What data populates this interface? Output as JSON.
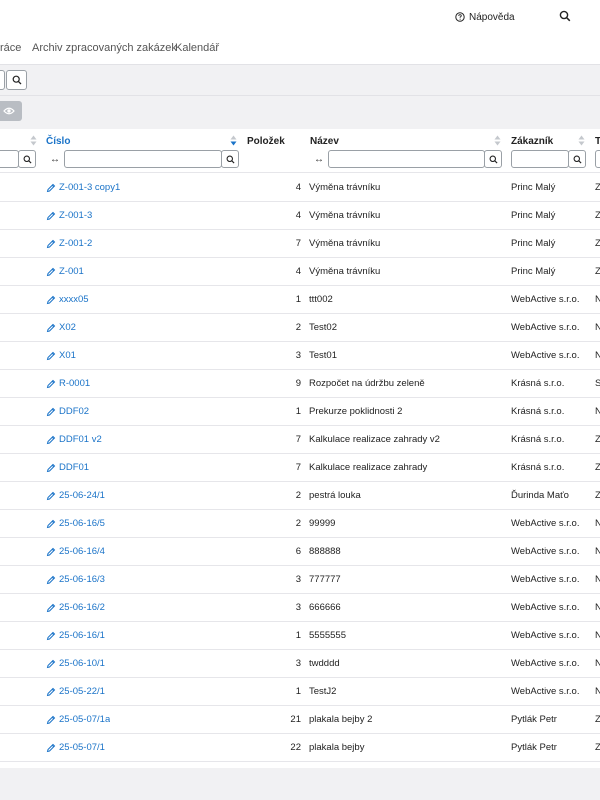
{
  "header": {
    "help_label": "Nápověda",
    "help_icon": "question-circle-icon",
    "search_icon": "search-icon"
  },
  "nav": {
    "items": [
      "ráce",
      "Archiv zpracovaných zakázek",
      "Kalendář"
    ]
  },
  "toolbar": {
    "search_icon": "search-icon",
    "visibility_icon": "eye-icon"
  },
  "table": {
    "columns": {
      "cislo": "Číslo",
      "polozek": "Položek",
      "nazev": "Název",
      "zakaznik": "Zákazník",
      "t": "T"
    },
    "expand_glyph": "↔",
    "accent_color": "#1a73c8",
    "rows": [
      {
        "cislo": "Z-001-3 copy1",
        "polozek": "4",
        "nazev": "Výměna trávníku",
        "zakaznik": "Princ Malý",
        "t": "Z"
      },
      {
        "cislo": "Z-001-3",
        "polozek": "4",
        "nazev": "Výměna trávníku",
        "zakaznik": "Princ Malý",
        "t": "Z"
      },
      {
        "cislo": "Z-001-2",
        "polozek": "7",
        "nazev": "Výměna trávníku",
        "zakaznik": "Princ Malý",
        "t": "Z"
      },
      {
        "cislo": "Z-001",
        "polozek": "4",
        "nazev": "Výměna trávníku",
        "zakaznik": "Princ Malý",
        "t": "Z"
      },
      {
        "cislo": "xxxx05",
        "polozek": "1",
        "nazev": "ttt002",
        "zakaznik": "WebActive s.r.o.",
        "t": "N"
      },
      {
        "cislo": "X02",
        "polozek": "2",
        "nazev": "Test02",
        "zakaznik": "WebActive s.r.o.",
        "t": "N"
      },
      {
        "cislo": "X01",
        "polozek": "3",
        "nazev": "Test01",
        "zakaznik": "WebActive s.r.o.",
        "t": "N"
      },
      {
        "cislo": "R-0001",
        "polozek": "9",
        "nazev": "Rozpočet na údržbu zeleně",
        "zakaznik": "Krásná s.r.o.",
        "t": "S"
      },
      {
        "cislo": "DDF02",
        "polozek": "1",
        "nazev": "Prekurze poklidnosti 2",
        "zakaznik": "Krásná s.r.o.",
        "t": "N"
      },
      {
        "cislo": "DDF01 v2",
        "polozek": "7",
        "nazev": "Kalkulace realizace zahrady v2",
        "zakaznik": "Krásná s.r.o.",
        "t": "Z"
      },
      {
        "cislo": "DDF01",
        "polozek": "7",
        "nazev": "Kalkulace realizace zahrady",
        "zakaznik": "Krásná s.r.o.",
        "t": "Z"
      },
      {
        "cislo": "25-06-24/1",
        "polozek": "2",
        "nazev": "pestrá louka",
        "zakaznik": "Ďurinda Maťo",
        "t": "Z"
      },
      {
        "cislo": "25-06-16/5",
        "polozek": "2",
        "nazev": "99999",
        "zakaznik": "WebActive s.r.o.",
        "t": "N"
      },
      {
        "cislo": "25-06-16/4",
        "polozek": "6",
        "nazev": "888888",
        "zakaznik": "WebActive s.r.o.",
        "t": "N"
      },
      {
        "cislo": "25-06-16/3",
        "polozek": "3",
        "nazev": "777777",
        "zakaznik": "WebActive s.r.o.",
        "t": "N"
      },
      {
        "cislo": "25-06-16/2",
        "polozek": "3",
        "nazev": "666666",
        "zakaznik": "WebActive s.r.o.",
        "t": "N"
      },
      {
        "cislo": "25-06-16/1",
        "polozek": "1",
        "nazev": "5555555",
        "zakaznik": "WebActive s.r.o.",
        "t": "N"
      },
      {
        "cislo": "25-06-10/1",
        "polozek": "3",
        "nazev": "twdddd",
        "zakaznik": "WebActive s.r.o.",
        "t": "N"
      },
      {
        "cislo": "25-05-22/1",
        "polozek": "1",
        "nazev": "TestJ2",
        "zakaznik": "WebActive s.r.o.",
        "t": "N"
      },
      {
        "cislo": "25-05-07/1a",
        "polozek": "21",
        "nazev": "plakala bejby 2",
        "zakaznik": "Pytlák Petr",
        "t": "Z"
      },
      {
        "cislo": "25-05-07/1",
        "polozek": "22",
        "nazev": "plakala bejby",
        "zakaznik": "Pytlák Petr",
        "t": "Z"
      }
    ]
  }
}
